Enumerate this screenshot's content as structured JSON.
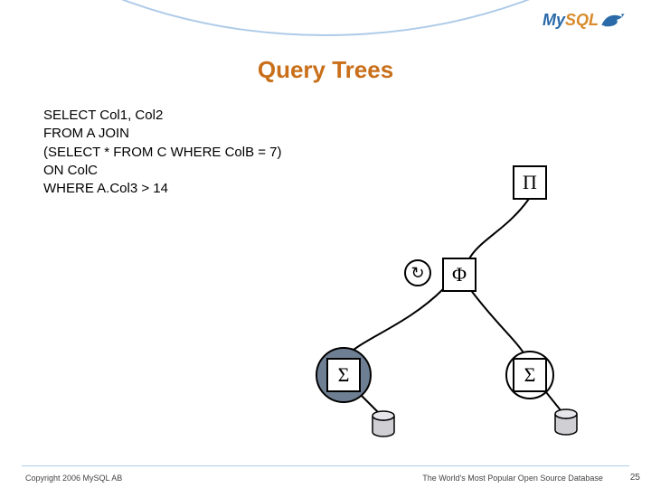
{
  "logo": {
    "part1": "My",
    "part2": "SQL"
  },
  "title": "Query Trees",
  "sql": {
    "l1": "SELECT Col1, Col2",
    "l2": "FROM A JOIN",
    "l3": "(SELECT * FROM C WHERE ColB = 7)",
    "l4": "ON ColC",
    "l5": "WHERE A.Col3 > 14"
  },
  "tree": {
    "project": "Π",
    "filter": "Φ",
    "sigma_left": "Σ",
    "sigma_right": "Σ",
    "refresh": "↻"
  },
  "footer": {
    "copyright": "Copyright 2006 MySQL AB",
    "tagline": "The World's Most Popular Open Source Database",
    "page": "25"
  }
}
